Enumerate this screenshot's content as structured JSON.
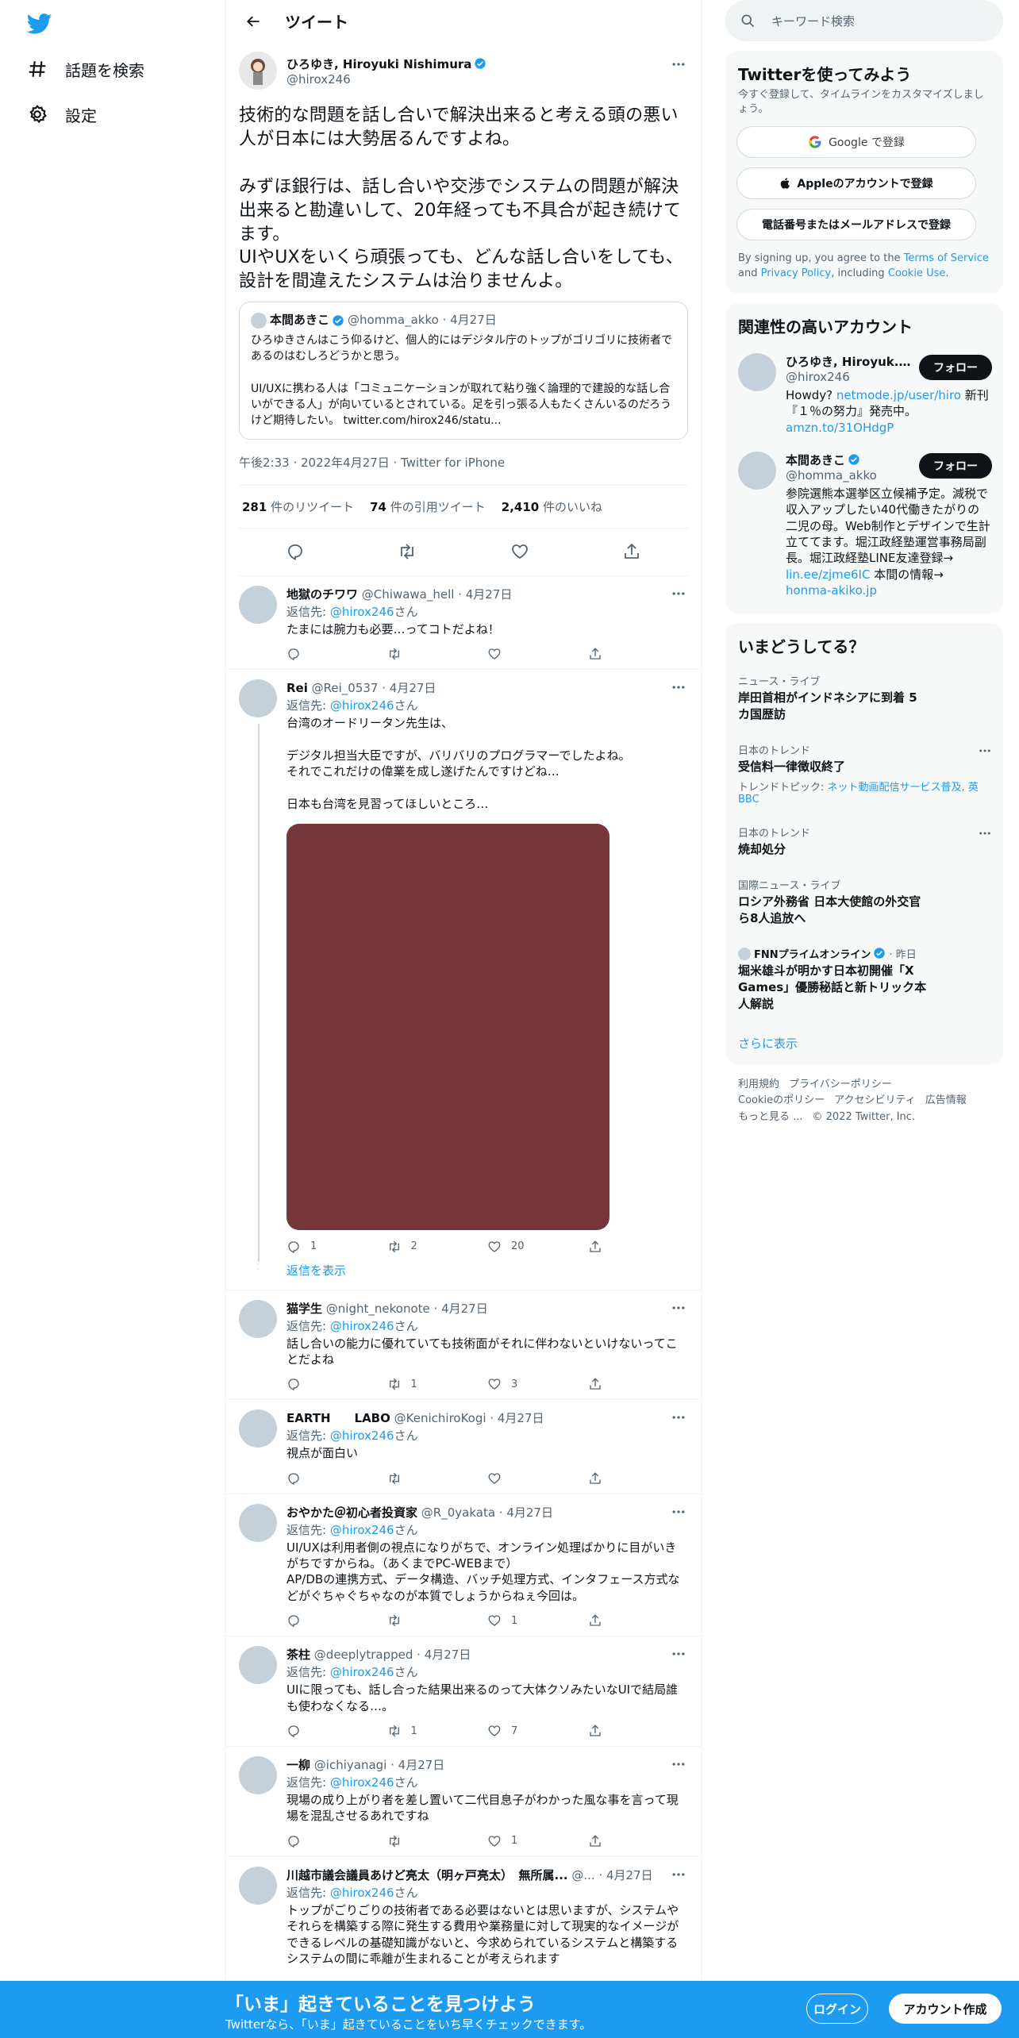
{
  "colors": {
    "brand": "#1d9bf0",
    "text": "#0f1419",
    "muted": "#536471",
    "media": "#743638"
  },
  "nav": {
    "explore_label": "話題を検索",
    "settings_label": "設定"
  },
  "header": {
    "title": "ツイート"
  },
  "main_tweet": {
    "name": "ひろゆき, Hiroyuki Nishimura",
    "handle": "@hirox246",
    "text": "技術的な問題を話し合いで解決出来ると考える頭の悪い人が日本には大勢居るんですよね。\n\nみずほ銀行は、話し合いや交渉でシステムの問題が解決出来ると勘違いして、20年経っても不具合が起き続けてます。\nUIやUXをいくら頑張っても、どんな話し合いをしても、設計を間違えたシステムは治りませんよ。",
    "quote": {
      "name": "本間あきこ",
      "handle": "@homma_akko",
      "date": "4月27日",
      "text": "ひろゆきさんはこう仰るけど、個人的にはデジタル庁のトップがゴリゴリに技術者であるのはむしろどうかと思う。\n\nUI/UXに携わる人は「コミュニケーションが取れて粘り強く論理的で建設的な話し合いができる人」が向いているとされている。足を引っ張る人もたくさんいるのだろうけど期待したい。 twitter.com/hirox246/statu..."
    },
    "time": "午後2:33 · 2022年4月27日 · Twitter for iPhone",
    "retweets": "281",
    "retweets_label": "件のリツイート",
    "quotes": "74",
    "quotes_label": "件の引用ツイート",
    "likes": "2,410",
    "likes_label": "件のいいね"
  },
  "reply_prefix": "返信先: ",
  "reply_to": "@hirox246",
  "reply_suffix": "さん",
  "show_replies_label": "返信を表示",
  "replies": [
    {
      "name": "地獄のチワワ",
      "handle": "@Chiwawa_hell",
      "date": "4月27日",
      "text": "たまには腕力も必要…ってコトだよね！",
      "reply_count": "",
      "rt_count": "",
      "like_count": ""
    },
    {
      "name": "Rei",
      "handle": "@Rei_0537",
      "date": "4月27日",
      "text": "台湾のオードリータン先生は、\n\nデジタル担当大臣ですが、バリバリのプログラマーでしたよね。\nそれでこれだけの偉業を成し遂げたんですけどね…\n\n日本も台湾を見習ってほしいところ…",
      "reply_count": "1",
      "rt_count": "2",
      "like_count": "20"
    },
    {
      "name": "猫学生",
      "handle": "@night_nekonote",
      "date": "4月27日",
      "text": "話し合いの能力に優れていても技術面がそれに伴わないといけないってことだよね",
      "reply_count": "",
      "rt_count": "1",
      "like_count": "3"
    },
    {
      "name": "EARTH　　LABO",
      "handle": "@KenichiroKogi",
      "date": "4月27日",
      "text": "視点が面白い",
      "reply_count": "",
      "rt_count": "",
      "like_count": ""
    },
    {
      "name": "おやかた＠初心者投資家",
      "handle": "@R_0yakata",
      "date": "4月27日",
      "text": "UI/UXは利用者側の視点になりがちで、オンライン処理ばかりに目がいきがちですからね。（あくまでPC-WEBまで）\nAP/DBの連携方式、データ構造、バッチ処理方式、インタフェース方式などがぐちゃぐちゃなのが本質でしょうからねぇ今回は。",
      "reply_count": "",
      "rt_count": "",
      "like_count": "1"
    },
    {
      "name": "茶柱",
      "handle": "@deeplytrapped",
      "date": "4月27日",
      "text": "UIに限っても、話し合った結果出来るのって大体クソみたいなUIで結局誰も使わなくなる…。",
      "reply_count": "",
      "rt_count": "1",
      "like_count": "7"
    },
    {
      "name": "一柳",
      "handle": "@ichiyanagi",
      "date": "4月27日",
      "text": "現場の成り上がり者を差し置いて二代目息子がわかった風な事を言って現場を混乱させるあれですね",
      "reply_count": "",
      "rt_count": "",
      "like_count": "1"
    },
    {
      "name": "川越市議会議員あけど亮太（明ヶ戸亮太）　無所属...",
      "handle": "@...",
      "date": "4月27日",
      "text": "トップがごりごりの技術者である必要はないとは思いますが、システムやそれらを構築する際に発生する費用や業務量に対して現実的なイメージができるレベルの基礎知識がないと、今求められているシステムと構築するシステムの間に乖離が生まれることが考えられます\n\n営業とSEのようなギャップのある関係",
      "reply_count": "",
      "rt_count": "",
      "like_count": ""
    }
  ],
  "search": {
    "placeholder": "キーワード検索"
  },
  "signup": {
    "title": "Twitterを使ってみよう",
    "sub": "今すぐ登録して、タイムラインをカスタマイズしましょう。",
    "google": "Google で登録",
    "apple": "Appleのアカウントで登録",
    "phone": "電話番号またはメールアドレスで登録",
    "legal_1": "By signing up, you agree to the ",
    "terms": "Terms of Service",
    "legal_2": " and ",
    "privacy": "Privacy Policy",
    "legal_3": ", including ",
    "cookie": "Cookie Use",
    "legal_4": "."
  },
  "related": {
    "title": "関連性の高いアカウント",
    "follow_label": "フォロー",
    "accounts": [
      {
        "name": "ひろゆき, Hiroyuk...",
        "handle": "@hirox246",
        "bio_1": "Howdy? ",
        "bio_link_1": "netmode.jp/user/hiro",
        "bio_2": " 新刊『１％の努力』発売中。 ",
        "bio_link_2": "amzn.to/31OHdgP",
        "bio_3": ""
      },
      {
        "name": "本間あきこ",
        "handle": "@homma_akko",
        "bio_1": "参院選熊本選挙区立候補予定。減税で収入アップしたい40代働きたがりの二児の母。Web制作とデザインで生計立ててます。堀江政経塾運営事務局副長。堀江政経塾LINE友達登録→ ",
        "bio_link_1": "lin.ee/zjme6IC",
        "bio_2": " 本間の情報→ ",
        "bio_link_2": "honma-akiko.jp",
        "bio_3": ""
      }
    ]
  },
  "trends": {
    "title": "いまどうしてる？",
    "items": [
      {
        "cat": "ニュース・ライブ",
        "title": "岸田首相がインドネシアに到着 5カ国歴訪",
        "topic": "",
        "more": false
      },
      {
        "cat": "日本のトレンド",
        "title": "受信料一律徴収終了",
        "topic_prefix": "トレンドトピック: ",
        "topic": "ネット動画配信サービス普及, 英BBC",
        "more": true
      },
      {
        "cat": "日本のトレンド",
        "title": "焼却処分",
        "topic": "",
        "more": true
      },
      {
        "cat": "国際ニュース・ライブ",
        "title": "ロシア外務省 日本大使館の外交官ら8人追放へ",
        "topic": "",
        "more": false
      },
      {
        "cat": "FNNプライムオンライン",
        "cat_suffix": " · 昨日",
        "title": "堀米雄斗が明かす日本初開催「X Games」優勝秘話と新トリック本人解説",
        "topic": "",
        "more": false
      }
    ],
    "show_more": "さらに表示"
  },
  "footer": {
    "links_row1": [
      "利用規約",
      "プライバシーポリシー"
    ],
    "links_row2": [
      "Cookieのポリシー",
      "アクセシビリティ",
      "広告情報"
    ],
    "more": "もっと見る ...",
    "copyright": "© 2022 Twitter, Inc."
  },
  "bottom_bar": {
    "headline": "「いま」起きていることを見つけよう",
    "sub": "Twitterなら、「いま」起きていることをいち早くチェックできます。",
    "login": "ログイン",
    "signup": "アカウント作成"
  }
}
